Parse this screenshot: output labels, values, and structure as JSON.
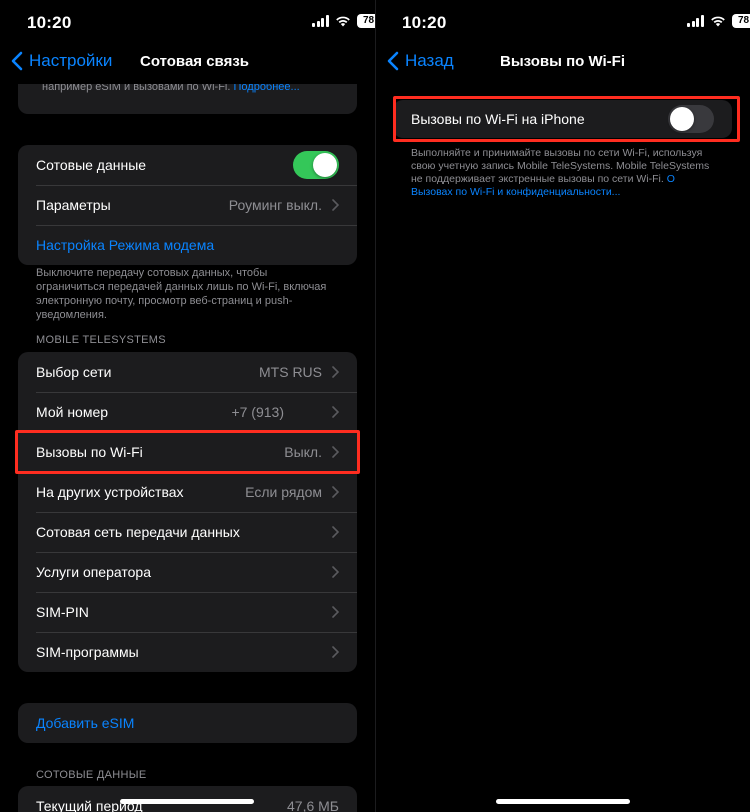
{
  "status_bar": {
    "time": "10:20",
    "battery": "78"
  },
  "left_screen": {
    "nav": {
      "back_label": "Настройки",
      "title": "Сотовая связь"
    },
    "top_partial": {
      "text": "например eSIM и вызовами по Wi-Fi.",
      "link": "Подробнее..."
    },
    "group_data": {
      "cellular_data_label": "Сотовые данные",
      "cellular_data_on": true,
      "parameters_label": "Параметры",
      "parameters_value": "Роуминг выкл.",
      "hotspot_label": "Настройка Режима модема"
    },
    "group_data_footer": "Выключите передачу сотовых данных, чтобы ограничиться передачей данных лишь по Wi-Fi, включая электронную почту, просмотр веб-страниц и push-уведомления.",
    "carrier_header": "MOBILE TELESYSTEMS",
    "carrier_rows": [
      {
        "label": "Выбор сети",
        "value": "MTS RUS"
      },
      {
        "label": "Мой номер",
        "value": "+7 (913)"
      },
      {
        "label": "Вызовы по Wi-Fi",
        "value": "Выкл."
      },
      {
        "label": "На других устройствах",
        "value": "Если рядом"
      },
      {
        "label": "Сотовая сеть передачи данных",
        "value": ""
      },
      {
        "label": "Услуги оператора",
        "value": ""
      },
      {
        "label": "SIM-PIN",
        "value": ""
      },
      {
        "label": "SIM-программы",
        "value": ""
      }
    ],
    "add_esim_label": "Добавить eSIM",
    "usage_header": "СОТОВЫЕ ДАННЫЕ",
    "usage_row": {
      "label": "Текущий период",
      "value": "47,6 МБ"
    }
  },
  "right_screen": {
    "nav": {
      "back_label": "Назад",
      "title": "Вызовы по Wi-Fi"
    },
    "toggle_label": "Вызовы по Wi-Fi на iPhone",
    "toggle_on": false,
    "footer_text": "Выполняйте и принимайте вызовы по сети Wi-Fi, используя свою учетную запись Mobile TeleSystems. Mobile TeleSystems не поддерживает экстренные вызовы по сети Wi-Fi.",
    "footer_link": "О Вызовах по Wi-Fi и конфиденциальности..."
  },
  "colors": {
    "accent": "#0a84ff",
    "highlight": "#ff2d20",
    "toggle_on": "#34c759"
  }
}
